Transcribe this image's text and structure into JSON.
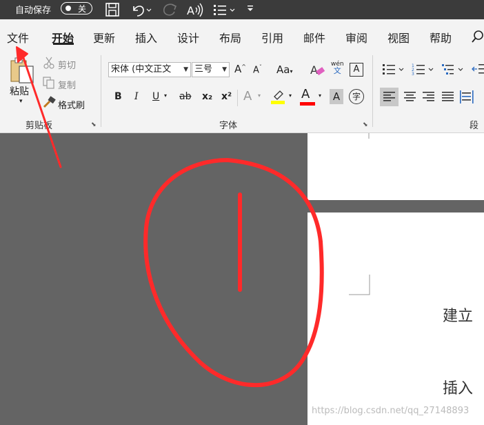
{
  "titlebar": {
    "autosave_label": "自动保存",
    "autosave_state": "关",
    "icons": [
      "save-icon",
      "undo-icon",
      "redo-icon",
      "read-aloud-icon",
      "list-icon",
      "customize-icon"
    ]
  },
  "tabs": [
    {
      "label": "文件"
    },
    {
      "label": "开始",
      "active": true
    },
    {
      "label": "更新"
    },
    {
      "label": "插入"
    },
    {
      "label": "设计"
    },
    {
      "label": "布局"
    },
    {
      "label": "引用"
    },
    {
      "label": "邮件"
    },
    {
      "label": "审阅"
    },
    {
      "label": "视图"
    },
    {
      "label": "帮助"
    }
  ],
  "clipboard": {
    "paste_label": "粘贴",
    "cut_label": "剪切",
    "copy_label": "复制",
    "format_painter_label": "格式刷",
    "group_label": "剪贴板"
  },
  "font": {
    "font_name": "宋体 (中文正文",
    "font_size": "三号",
    "grow_label": "A",
    "shrink_label": "A",
    "case_label": "Aa",
    "phonetic_top": "wén",
    "phonetic_bottom": "文",
    "border_char": "A",
    "bold": "B",
    "italic": "I",
    "underline": "U",
    "strike": "ab",
    "subscript": "x₂",
    "superscript": "x²",
    "text_effect": "A",
    "font_color": "A",
    "char_shading": "A",
    "enclose_char": "字",
    "group_label": "字体",
    "highlight_color": "#ffff00",
    "font_color_value": "#ff0000"
  },
  "paragraph": {
    "group_label": "段落"
  },
  "document": {
    "line1": "建立",
    "line2": "插入"
  },
  "watermark": "https://blog.csdn.net/qq_27148893",
  "annotation_color": "#ff2a2a"
}
